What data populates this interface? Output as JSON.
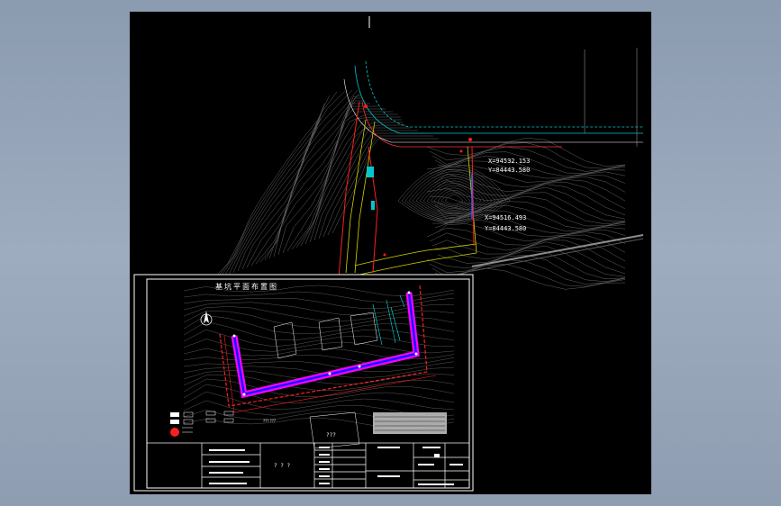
{
  "viewport": {
    "background_color": "#000000",
    "window_background": "#9aa9bc"
  },
  "drawing": {
    "coordinates": [
      "X=94532.153",
      "Y=84443.580",
      "X=94516.493",
      "Y=84443.580"
    ],
    "inset_title": "基坑平面布置图",
    "plan_note": "??? ???",
    "stamp_text": "???",
    "titleblock_center": "? ? ?",
    "colors": {
      "contour": "#6e6e6e",
      "road": "#d4d400",
      "water": "#00c8d2",
      "boundary_red": "#ff1e1e",
      "pit_magenta": "#ff00ff",
      "pit_blue": "#1414ff",
      "frame": "#ffffff",
      "highlight": "#00e6e6"
    }
  }
}
